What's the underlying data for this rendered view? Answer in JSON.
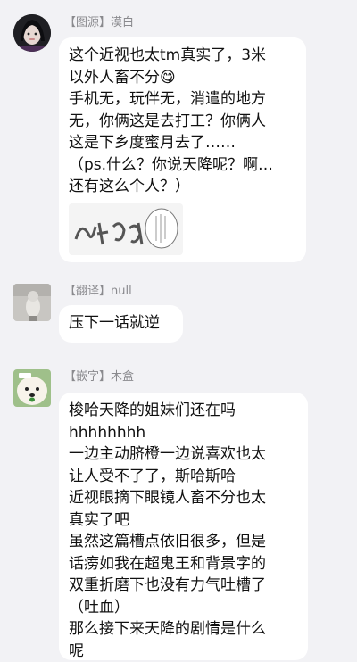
{
  "messages": [
    {
      "sender": "【图源】漠白",
      "lines": [
        "这个近视也太tm真实了，3米",
        "以外人畜不分😋",
        "手机无，玩伴无，消遣的地方",
        "无，你俩这是去打工？你俩人",
        "这是下乡度蜜月去了……",
        "（ps.什么？你说天降呢？啊…",
        "还有这么个人？）"
      ],
      "sticker_icon": "manga-sticker-icon"
    },
    {
      "sender": "【翻译】null",
      "lines": [
        "压下一话就逆"
      ]
    },
    {
      "sender": "【嵌字】木盒",
      "lines": [
        "梭哈天降的姐妹们还在吗",
        "hhhhhhhh",
        "一边主动脐橙一边说喜欢也太",
        "让人受不了了，斯哈斯哈",
        "近视眼摘下眼镜人畜不分也太",
        "真实了吧",
        "虽然这篇槽点依旧很多，但是",
        "话痨如我在超鬼王和背景字的",
        "双重折磨下也没有力气吐槽了",
        "（吐血）",
        "那么接下来天降的剧情是什么",
        "呢"
      ]
    }
  ],
  "colors": {
    "background": "#f2f2f5",
    "bubble": "#ffffff",
    "sender_name": "#8a8a8e"
  }
}
